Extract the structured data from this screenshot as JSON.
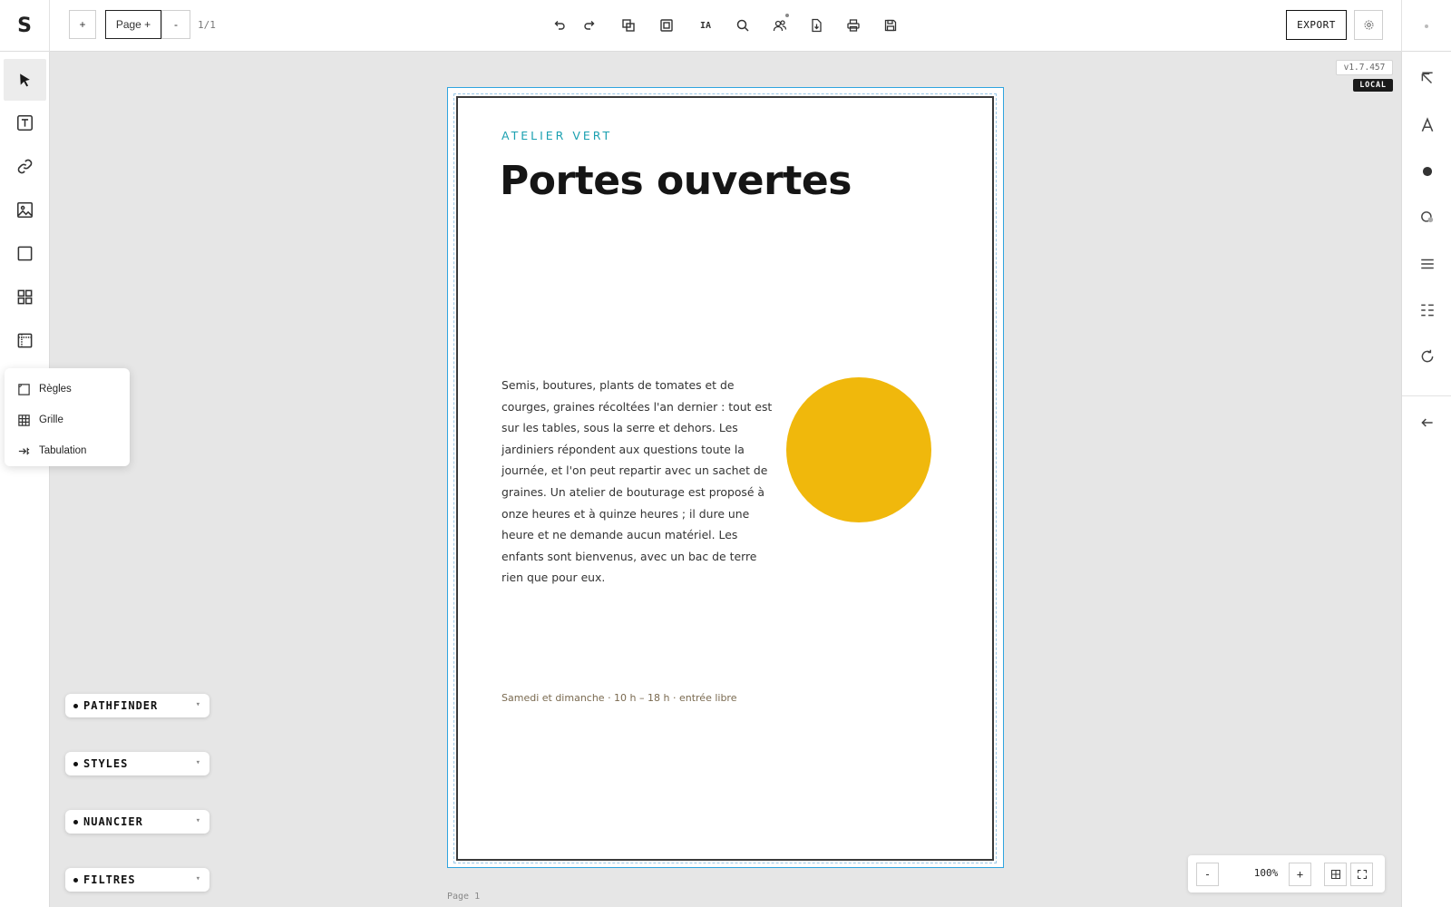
{
  "app": {
    "logo": "S"
  },
  "toolbar": {
    "add_label": "+",
    "page_menu_label": "Page +",
    "page_remove_label": "-",
    "page_count": "1/1",
    "ai_label": "IA",
    "export_label": "EXPORT"
  },
  "left_tools": [
    {
      "name": "select-tool",
      "icon": "cursor-icon"
    },
    {
      "name": "text-tool",
      "icon": "text-box-icon"
    },
    {
      "name": "link-tool",
      "icon": "link-icon"
    },
    {
      "name": "image-tool",
      "icon": "image-icon"
    },
    {
      "name": "rectangle-tool",
      "icon": "square-icon"
    },
    {
      "name": "components-tool",
      "icon": "grid-icon"
    },
    {
      "name": "rulers-tool",
      "icon": "ruler-frame-icon"
    }
  ],
  "popup_menu": {
    "items": [
      {
        "label": "Règles",
        "icon": "ruler-icon"
      },
      {
        "label": "Grille",
        "icon": "grid-table-icon"
      },
      {
        "label": "Tabulation",
        "icon": "tab-icon"
      }
    ]
  },
  "panels": [
    {
      "label": "PATHFINDER"
    },
    {
      "label": "STYLES"
    },
    {
      "label": "NUANCIER"
    },
    {
      "label": "FILTRES"
    }
  ],
  "badges": {
    "version": "v1.7.457",
    "mode": "LOCAL"
  },
  "document": {
    "kicker": "ATELIER VERT",
    "title": "Portes ouvertes",
    "body": "Semis, boutures, plants de tomates et de courges, graines récoltées l'an dernier : tout est sur les tables, sous la serre et dehors. Les jardiniers répondent aux questions toute la journée, et l'on peut repartir avec un sachet de graines. Un atelier de bouturage est proposé à onze heures et à quinze heures ; il dure une heure et ne demande aucun matériel. Les enfants sont bienvenus, avec un bac de terre rien que pour eux.",
    "footer": "Samedi et dimanche · 10 h – 18 h · entrée libre",
    "page_label": "Page 1",
    "accent_color": "#1aa0b0",
    "sun_color": "#f0b80c"
  },
  "zoom": {
    "minus_label": "-",
    "value": "100%",
    "plus_label": "+"
  }
}
